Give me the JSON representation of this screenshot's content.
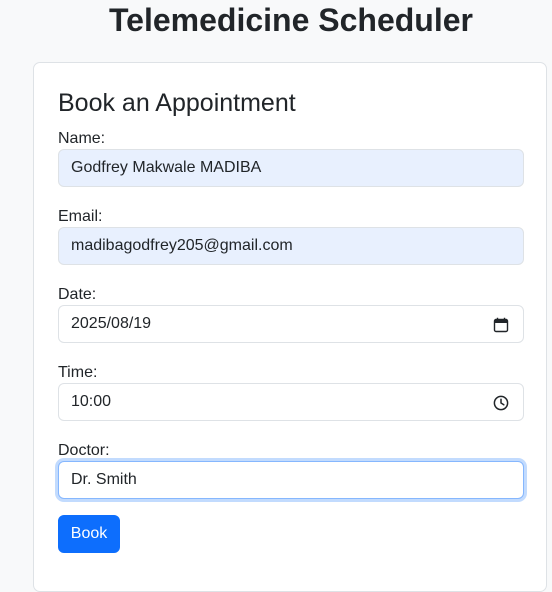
{
  "page": {
    "title": "Telemedicine Scheduler"
  },
  "form": {
    "heading": "Book an Appointment",
    "name": {
      "label": "Name:",
      "value": "Godfrey Makwale MADIBA"
    },
    "email": {
      "label": "Email:",
      "value": "madibagodfrey205@gmail.com"
    },
    "date": {
      "label": "Date:",
      "value": "2025/08/19",
      "icon": "calendar-icon"
    },
    "time": {
      "label": "Time:",
      "value": "10:00",
      "icon": "clock-icon"
    },
    "doctor": {
      "label": "Doctor:",
      "value": "Dr. Smith"
    },
    "submit_label": "Book"
  },
  "colors": {
    "primary": "#0d6efd",
    "autofill_background": "#e8f0fe",
    "focus_border": "#86b7fe",
    "page_background": "#f8f9fa"
  }
}
